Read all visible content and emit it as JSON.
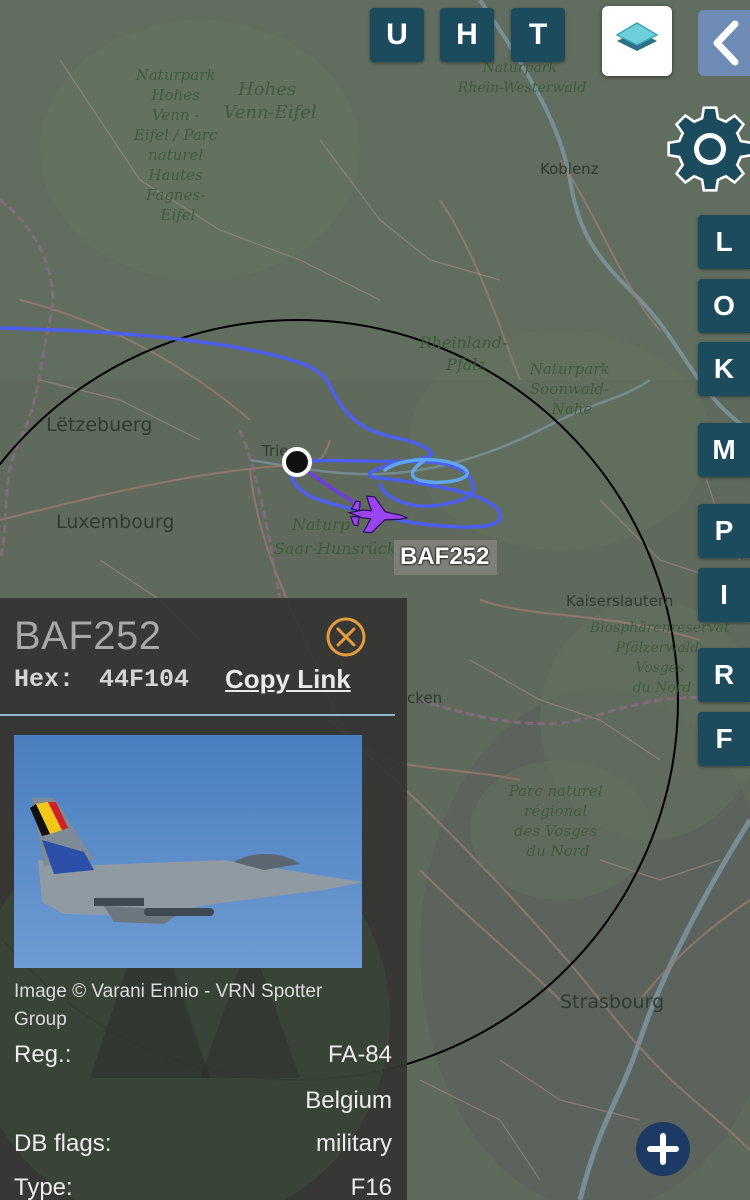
{
  "map": {
    "labels": {
      "naturpark_hohes_venn": "Naturpark\nHohes\nVenn -\nEifel / Parc\nnaturel\nHautes\nFagnes-\nEifel",
      "hohes_venn_eifel": "Hohes\nVenn-Eifel",
      "naturpark_rhein_westerwald": "Naturpark\nRhein-Westerwald",
      "koblenz": "Koblenz",
      "rheinland_pfalz": "Rheinland-\nPfalz",
      "naturpark_soonwald": "Naturpark\nSoonwald-\nNahe",
      "letzebuerg": "Lëtzebuerg",
      "luxembourg": "Luxembourg",
      "trier": "Trie",
      "naturpark_saar": "Naturp",
      "saar_hunsrueck": "Saar-Hunsrück",
      "kaiserslautern": "Kaiserslautern",
      "biosphaere": "Biosphärenreservat\nPfälzerwald-\nVosges\ndu Nord",
      "parc_vosges": "Parc naturel\nrégional\ndes Vosges\ndu Nord",
      "strasbourg": "Strasbourg",
      "cken": "cken"
    },
    "colors": {
      "base": "#5f6a5c",
      "track_blue": "#4d5ff0",
      "track_purple": "#6b3fe0",
      "track_light": "#5fa6f0",
      "aircraft": "#9b45f0",
      "range_ring": "#000000"
    }
  },
  "toolbar": {
    "buttons": [
      "U",
      "H",
      "T"
    ],
    "layers_icon": "layers-icon",
    "back_icon": "chevron-left-icon",
    "settings_icon": "gear-icon"
  },
  "sidebar": {
    "buttons": [
      "L",
      "O",
      "K",
      "M",
      "P",
      "I",
      "R",
      "F"
    ]
  },
  "aircraft": {
    "label": "BAF252",
    "icon": "fighter-jet-icon"
  },
  "panel": {
    "callsign": "BAF252",
    "hex_label": "Hex:",
    "hex_value": "44F104",
    "copy_link": "Copy Link",
    "image_credit": "Image © Varani Ennio - VRN Spotter Group",
    "rows": [
      {
        "key": "Reg.:",
        "value": "FA-84"
      },
      {
        "key": "",
        "value": "Belgium"
      },
      {
        "key": "DB flags:",
        "value": "military"
      },
      {
        "key": "Type:",
        "value": "F16"
      }
    ]
  },
  "zoom": {
    "in_icon": "plus-icon"
  }
}
